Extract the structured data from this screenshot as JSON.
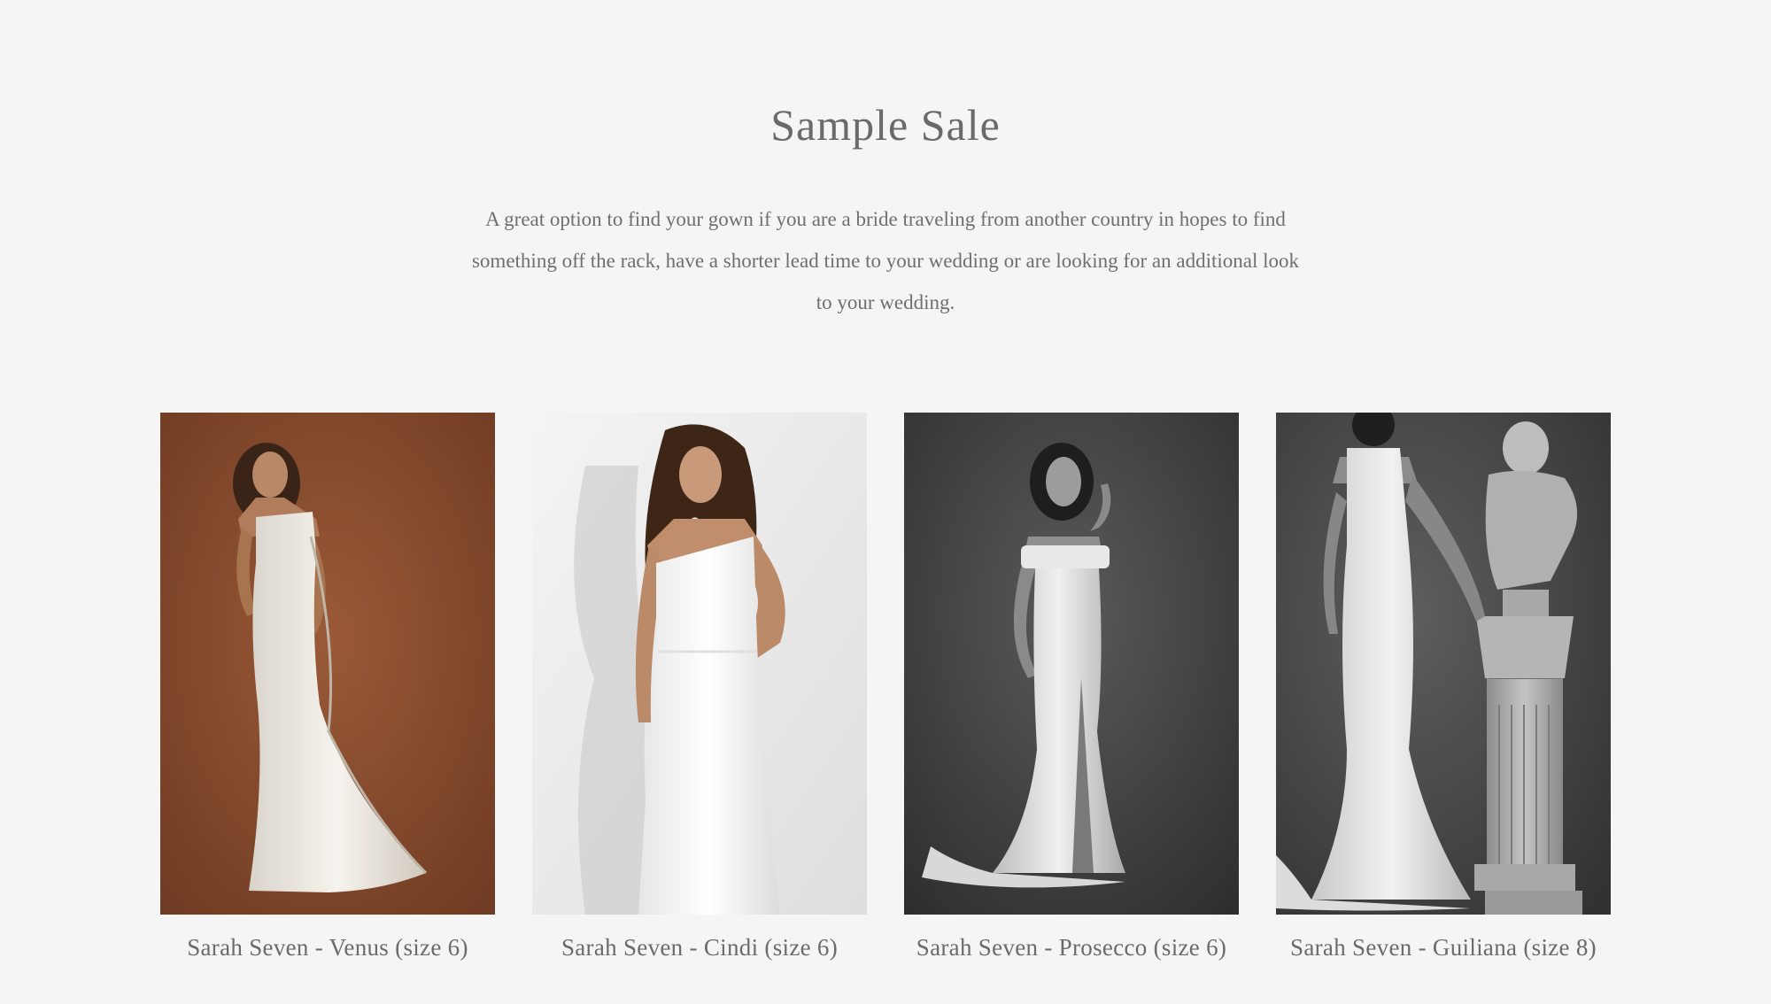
{
  "section": {
    "title": "Sample Sale",
    "intro_lines": [
      "A great option to find your gown if you are a bride traveling from another country in hopes to find",
      "something off the rack, have a shorter lead time to your wedding or are looking for an additional look",
      "to your wedding."
    ]
  },
  "products": [
    {
      "name": "Sarah Seven - Venus (size 6)",
      "photo_icon": "bride-photo-icon",
      "background": "#8a4e30"
    },
    {
      "name": "Sarah Seven - Cindi (size 6)",
      "photo_icon": "bride-photo-icon",
      "background": "#eeeeee"
    },
    {
      "name": "Sarah Seven - Prosecco (size 6)",
      "photo_icon": "bride-photo-icon",
      "background": "#3c3c3c"
    },
    {
      "name": "Sarah Seven - Guiliana (size 8)",
      "photo_icon": "bride-photo-icon",
      "background": "#4a4a4a"
    }
  ]
}
